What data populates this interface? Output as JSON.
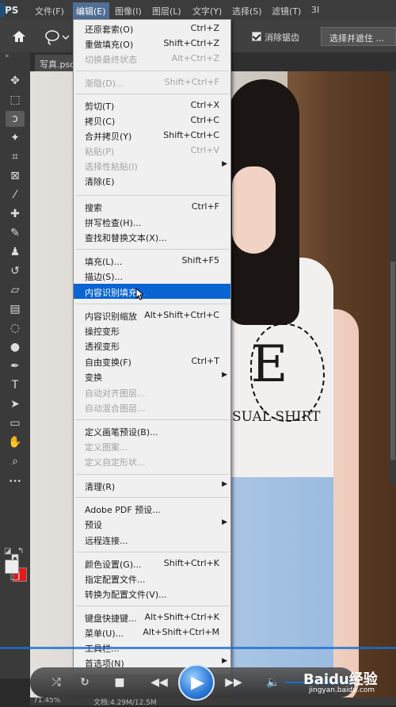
{
  "app": {
    "logo": "PS"
  },
  "menubar": {
    "items": [
      {
        "label": "文件(F)"
      },
      {
        "label": "编辑(E)"
      },
      {
        "label": "图像(I)"
      },
      {
        "label": "图层(L)"
      },
      {
        "label": "文字(Y)"
      },
      {
        "label": "选择(S)"
      },
      {
        "label": "滤镜(T)"
      },
      {
        "label": "3I"
      }
    ]
  },
  "options": {
    "antialias_label": "消除锯齿",
    "antialias_checked": true,
    "select_mask_label": "选择并遮住 ..."
  },
  "document": {
    "tab_label": "写真.psd"
  },
  "toolbar": {
    "tools": [
      {
        "name": "move-tool",
        "glyph": "✥"
      },
      {
        "name": "marquee-tool",
        "glyph": "⬚"
      },
      {
        "name": "lasso-tool",
        "glyph": "ↄ",
        "selected": true
      },
      {
        "name": "magic-wand-tool",
        "glyph": "✦"
      },
      {
        "name": "crop-tool",
        "glyph": "⌗"
      },
      {
        "name": "frame-tool",
        "glyph": "⊠"
      },
      {
        "name": "eyedropper-tool",
        "glyph": "⁄"
      },
      {
        "name": "healing-tool",
        "glyph": "✚"
      },
      {
        "name": "brush-tool",
        "glyph": "✎"
      },
      {
        "name": "stamp-tool",
        "glyph": "♟"
      },
      {
        "name": "history-brush-tool",
        "glyph": "↺"
      },
      {
        "name": "eraser-tool",
        "glyph": "▱"
      },
      {
        "name": "gradient-tool",
        "glyph": "▤"
      },
      {
        "name": "blur-tool",
        "glyph": "◌"
      },
      {
        "name": "dodge-tool",
        "glyph": "●"
      },
      {
        "name": "pen-tool",
        "glyph": "✒"
      },
      {
        "name": "type-tool",
        "glyph": "T"
      },
      {
        "name": "path-select-tool",
        "glyph": "➤"
      },
      {
        "name": "shape-tool",
        "glyph": "▭"
      },
      {
        "name": "hand-tool",
        "glyph": "✋"
      },
      {
        "name": "zoom-tool",
        "glyph": "⌕"
      },
      {
        "name": "more-tools",
        "glyph": "•••"
      }
    ],
    "fg_color": "#ededed",
    "bg_color": "#e01b1b"
  },
  "edit_menu": {
    "items": [
      {
        "label": "还原套索(O)",
        "shortcut": "Ctrl+Z",
        "disabled": false
      },
      {
        "label": "重做填充(O)",
        "shortcut": "Shift+Ctrl+Z",
        "disabled": false
      },
      {
        "label": "切换最终状态",
        "shortcut": "Alt+Ctrl+Z",
        "disabled": true
      },
      {
        "label": "渐隐(D)...",
        "shortcut": "Shift+Ctrl+F",
        "disabled": true
      },
      {
        "label": "剪切(T)",
        "shortcut": "Ctrl+X",
        "disabled": false
      },
      {
        "label": "拷贝(C)",
        "shortcut": "Ctrl+C",
        "disabled": false
      },
      {
        "label": "合并拷贝(Y)",
        "shortcut": "Shift+Ctrl+C",
        "disabled": false
      },
      {
        "label": "粘贴(P)",
        "shortcut": "Ctrl+V",
        "disabled": true
      },
      {
        "label": "选择性粘贴(I)",
        "shortcut": "",
        "disabled": true,
        "submenu": true
      },
      {
        "label": "清除(E)",
        "shortcut": "",
        "disabled": false
      },
      {
        "label": "搜索",
        "shortcut": "Ctrl+F",
        "disabled": false
      },
      {
        "label": "拼写检查(H)...",
        "shortcut": "",
        "disabled": false
      },
      {
        "label": "查找和替换文本(X)...",
        "shortcut": "",
        "disabled": false
      },
      {
        "label": "填充(L)...",
        "shortcut": "Shift+F5",
        "disabled": false
      },
      {
        "label": "描边(S)...",
        "shortcut": "",
        "disabled": false
      },
      {
        "label": "内容识别填充...",
        "shortcut": "",
        "disabled": false,
        "highlight": true
      },
      {
        "label": "内容识别缩放",
        "shortcut": "Alt+Shift+Ctrl+C",
        "disabled": false
      },
      {
        "label": "操控变形",
        "shortcut": "",
        "disabled": false
      },
      {
        "label": "透视变形",
        "shortcut": "",
        "disabled": false
      },
      {
        "label": "自由变换(F)",
        "shortcut": "Ctrl+T",
        "disabled": false
      },
      {
        "label": "变换",
        "shortcut": "",
        "disabled": false,
        "submenu": true
      },
      {
        "label": "自动对齐图层...",
        "shortcut": "",
        "disabled": true
      },
      {
        "label": "自动混合图层...",
        "shortcut": "",
        "disabled": true
      },
      {
        "label": "定义画笔预设(B)...",
        "shortcut": "",
        "disabled": false
      },
      {
        "label": "定义图案...",
        "shortcut": "",
        "disabled": true
      },
      {
        "label": "定义自定形状...",
        "shortcut": "",
        "disabled": true
      },
      {
        "label": "清理(R)",
        "shortcut": "",
        "disabled": false,
        "submenu": true
      },
      {
        "label": "Adobe PDF 预设...",
        "shortcut": "",
        "disabled": false
      },
      {
        "label": "预设",
        "shortcut": "",
        "disabled": false,
        "submenu": true
      },
      {
        "label": "远程连接...",
        "shortcut": "",
        "disabled": false
      },
      {
        "label": "颜色设置(G)...",
        "shortcut": "Shift+Ctrl+K",
        "disabled": false
      },
      {
        "label": "指定配置文件...",
        "shortcut": "",
        "disabled": false
      },
      {
        "label": "转换为配置文件(V)...",
        "shortcut": "",
        "disabled": false
      },
      {
        "label": "键盘快捷键...",
        "shortcut": "Alt+Shift+Ctrl+K",
        "disabled": false
      },
      {
        "label": "菜单(U)...",
        "shortcut": "Alt+Shift+Ctrl+M",
        "disabled": false
      },
      {
        "label": "工具栏...",
        "shortcut": "",
        "disabled": false
      },
      {
        "label": "首选项(N)",
        "shortcut": "",
        "disabled": false,
        "submenu": true
      }
    ]
  },
  "artwork": {
    "shirt_text": "SUAL SHIRT",
    "shirt_logo": "E"
  },
  "status_bar": {
    "zoom": "71.45%",
    "doc_info": "文档:4.29M/12.5M"
  },
  "watermark": {
    "brand": "Baidu经验",
    "url": "jingyan.baidu.com"
  }
}
